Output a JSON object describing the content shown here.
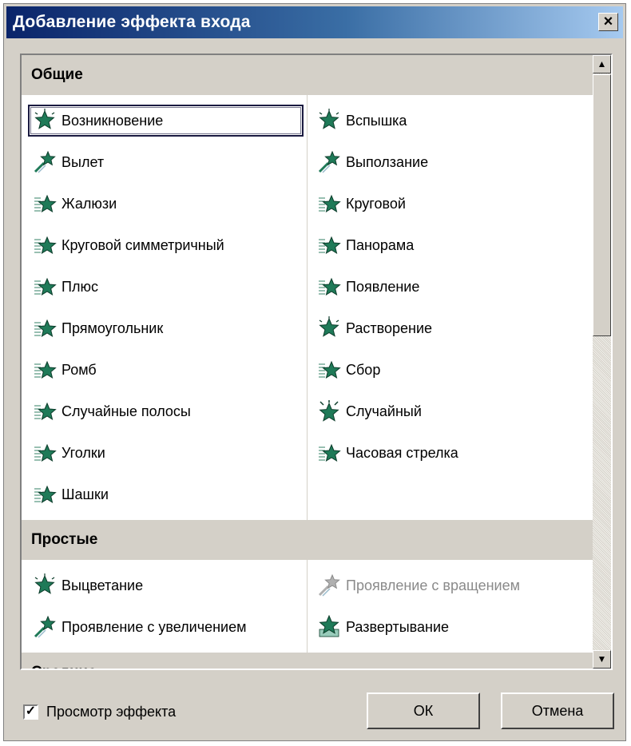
{
  "window": {
    "title": "Добавление эффекта входа",
    "close_label": "×"
  },
  "groups": [
    {
      "header": "Общие",
      "rows": 10,
      "col0": [
        "Возникновение",
        "Вылет",
        "Жалюзи",
        "Круговой симметричный",
        "Плюс",
        "Прямоугольник",
        "Ромб",
        "Случайные полосы",
        "Уголки",
        "Шашки"
      ],
      "col1": [
        "Вспышка",
        "Выползание",
        "Круговой",
        "Панорама",
        "Появление",
        "Растворение",
        "Сбор",
        "Случайный",
        "Часовая стрелка"
      ]
    },
    {
      "header": "Простые",
      "rows": 2,
      "col0": [
        "Выцветание",
        "Проявление с увеличением"
      ],
      "col1": [
        "Проявление с вращением",
        "Развертывание"
      ]
    },
    {
      "header": "Средние",
      "rows": 0,
      "col0": [],
      "col1": []
    }
  ],
  "icons": {
    "Общие": {
      "col0": [
        "star-appear-icon",
        "star-fly-icon",
        "star-blinds-icon",
        "star-blinds-icon",
        "star-blinds-icon",
        "star-blinds-icon",
        "star-blinds-icon",
        "star-blinds-icon",
        "star-blinds-icon",
        "star-blinds-icon"
      ],
      "col1": [
        "star-appear-icon",
        "star-fly-icon",
        "star-blinds-icon",
        "star-blinds-icon",
        "star-blinds-icon",
        "star-appear-icon",
        "star-blinds-icon",
        "star-random-icon",
        "star-blinds-icon"
      ]
    },
    "Простые": {
      "col0": [
        "star-appear-icon",
        "star-fly-icon"
      ],
      "col1": [
        "star-fly-icon",
        "star-unfold-icon"
      ]
    }
  },
  "selected_item": "Возникновение",
  "disabled_items": [
    "Проявление с вращением"
  ],
  "scrollbar": {
    "up_glyph": "▲",
    "down_glyph": "▼"
  },
  "footer": {
    "preview_checkbox": {
      "label": "Просмотр эффекта",
      "checked": true,
      "glyph": "✓"
    },
    "ok_label": "ОК",
    "cancel_label": "Отмена"
  },
  "colors": {
    "star_green": "#1f7a58",
    "star_dark": "#0d3d2b",
    "title_bar_start": "#0a246a",
    "title_bar_end": "#a6caf0",
    "dialog_bg": "#d4d0c8"
  }
}
